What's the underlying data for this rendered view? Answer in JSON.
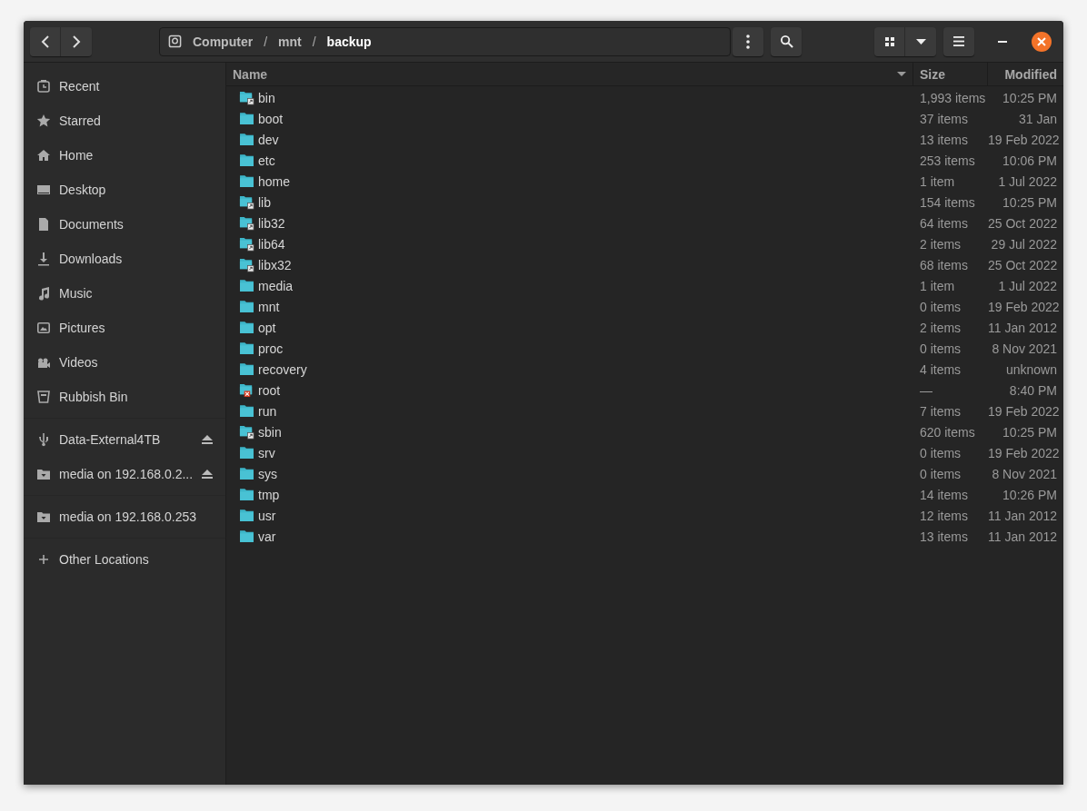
{
  "header": {
    "separator": "/",
    "path": [
      {
        "label": "Computer",
        "kind": "drive",
        "selected": false
      },
      {
        "label": "mnt",
        "kind": "folder",
        "selected": false
      },
      {
        "label": "backup",
        "kind": "folder",
        "selected": true
      }
    ]
  },
  "sidebar": {
    "groups": [
      [
        {
          "label": "Recent",
          "kind": "recent",
          "eject": false
        },
        {
          "label": "Starred",
          "kind": "starred",
          "eject": false
        },
        {
          "label": "Home",
          "kind": "home",
          "eject": false
        },
        {
          "label": "Desktop",
          "kind": "desktop",
          "eject": false
        },
        {
          "label": "Documents",
          "kind": "documents",
          "eject": false
        },
        {
          "label": "Downloads",
          "kind": "downloads",
          "eject": false
        },
        {
          "label": "Music",
          "kind": "music",
          "eject": false
        },
        {
          "label": "Pictures",
          "kind": "pictures",
          "eject": false
        },
        {
          "label": "Videos",
          "kind": "videos",
          "eject": false
        },
        {
          "label": "Rubbish Bin",
          "kind": "trash",
          "eject": false
        }
      ],
      [
        {
          "label": "Data-External4TB",
          "kind": "usb",
          "eject": true
        },
        {
          "label": "media on 192.168.0.2...",
          "kind": "share",
          "eject": true
        }
      ],
      [
        {
          "label": "media on 192.168.0.253",
          "kind": "share",
          "eject": false
        }
      ],
      [
        {
          "label": "Other Locations",
          "kind": "other",
          "eject": false
        }
      ]
    ]
  },
  "table": {
    "columns": [
      "Name",
      "Size",
      "Modified"
    ],
    "rows": [
      {
        "name": "bin",
        "kind": "link",
        "size": "1,993 items",
        "modified": "10:25 PM"
      },
      {
        "name": "boot",
        "kind": "folder",
        "size": "37 items",
        "modified": "31 Jan"
      },
      {
        "name": "dev",
        "kind": "folder",
        "size": "13 items",
        "modified": "19 Feb 2022"
      },
      {
        "name": "etc",
        "kind": "folder",
        "size": "253 items",
        "modified": "10:06 PM"
      },
      {
        "name": "home",
        "kind": "folder",
        "size": "1 item",
        "modified": "1 Jul 2022"
      },
      {
        "name": "lib",
        "kind": "link",
        "size": "154 items",
        "modified": "10:25 PM"
      },
      {
        "name": "lib32",
        "kind": "link",
        "size": "64 items",
        "modified": "25 Oct 2022"
      },
      {
        "name": "lib64",
        "kind": "link",
        "size": "2 items",
        "modified": "29 Jul 2022"
      },
      {
        "name": "libx32",
        "kind": "link",
        "size": "68 items",
        "modified": "25 Oct 2022"
      },
      {
        "name": "media",
        "kind": "folder",
        "size": "1 item",
        "modified": "1 Jul 2022"
      },
      {
        "name": "mnt",
        "kind": "folder",
        "size": "0 items",
        "modified": "19 Feb 2022"
      },
      {
        "name": "opt",
        "kind": "folder",
        "size": "2 items",
        "modified": "11 Jan 2012"
      },
      {
        "name": "proc",
        "kind": "folder",
        "size": "0 items",
        "modified": "8 Nov 2021"
      },
      {
        "name": "recovery",
        "kind": "folder",
        "size": "4 items",
        "modified": "unknown"
      },
      {
        "name": "root",
        "kind": "locked",
        "size": "—",
        "modified": "8:40 PM"
      },
      {
        "name": "run",
        "kind": "folder",
        "size": "7 items",
        "modified": "19 Feb 2022"
      },
      {
        "name": "sbin",
        "kind": "link",
        "size": "620 items",
        "modified": "10:25 PM"
      },
      {
        "name": "srv",
        "kind": "folder",
        "size": "0 items",
        "modified": "19 Feb 2022"
      },
      {
        "name": "sys",
        "kind": "folder",
        "size": "0 items",
        "modified": "8 Nov 2021"
      },
      {
        "name": "tmp",
        "kind": "folder",
        "size": "14 items",
        "modified": "10:26 PM"
      },
      {
        "name": "usr",
        "kind": "folder",
        "size": "12 items",
        "modified": "11 Jan 2012"
      },
      {
        "name": "var",
        "kind": "folder",
        "size": "13 items",
        "modified": "11 Jan 2012"
      }
    ]
  }
}
